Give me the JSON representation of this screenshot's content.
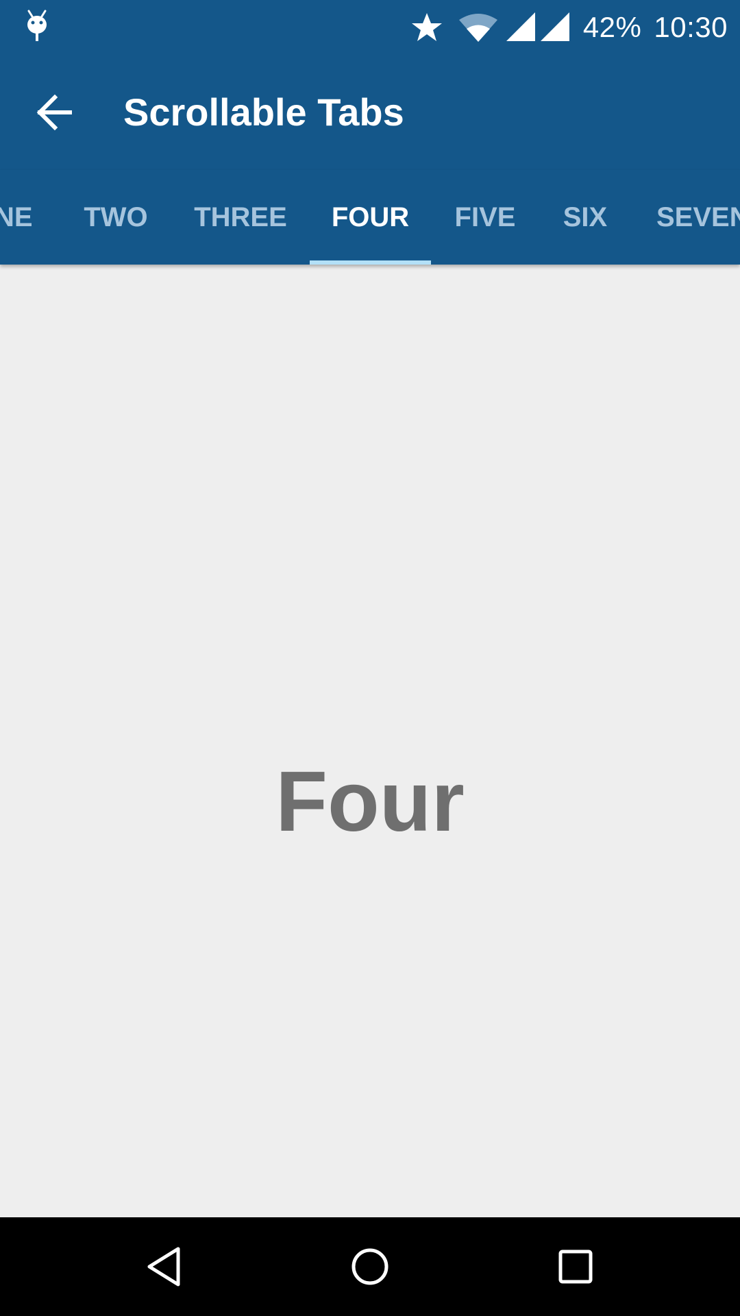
{
  "status_bar": {
    "battery_percent": "42%",
    "time": "10:30",
    "icons": [
      "android-debug-icon",
      "star-icon",
      "wifi-icon",
      "signal-icon",
      "signal-icon"
    ]
  },
  "app_bar": {
    "title": "Scrollable Tabs",
    "back_icon": "arrow-back-icon"
  },
  "tabs": {
    "items": [
      {
        "label": "NE"
      },
      {
        "label": "TWO"
      },
      {
        "label": "THREE"
      },
      {
        "label": "FOUR"
      },
      {
        "label": "FIVE"
      },
      {
        "label": "SIX"
      },
      {
        "label": "SEVEN"
      }
    ],
    "selected": "FOUR"
  },
  "content": {
    "page_label": "Four"
  },
  "nav_bar": {
    "icons": [
      "back-triangle-icon",
      "home-circle-icon",
      "recents-square-icon"
    ]
  },
  "colors": {
    "primary": "#14578a",
    "tab_inactive": "#a6c4dd",
    "tab_indicator": "#b3e0f7",
    "background": "#eeeeee",
    "page_label": "#6f6f6f"
  }
}
